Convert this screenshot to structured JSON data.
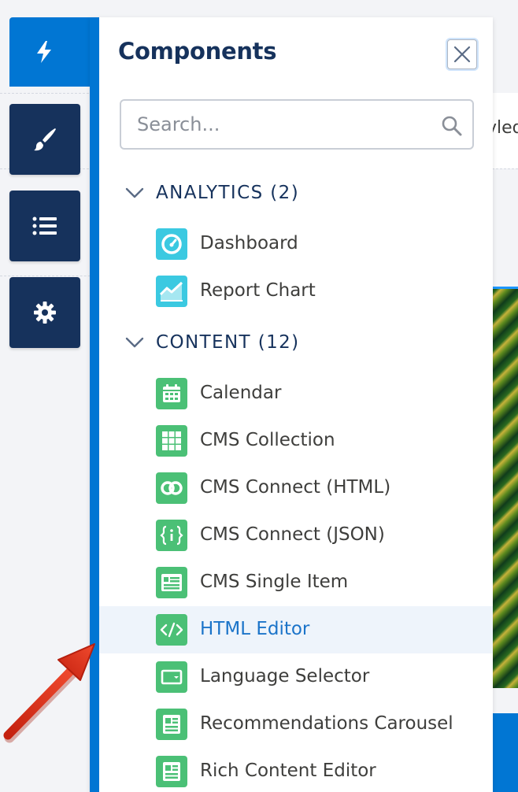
{
  "background": {
    "peek_text": "vled"
  },
  "rail": {
    "items": [
      {
        "icon": "lightning-icon",
        "active": true
      },
      {
        "icon": "paintbrush-icon",
        "active": false
      },
      {
        "icon": "list-icon",
        "active": false
      },
      {
        "icon": "gear-icon",
        "active": false
      }
    ]
  },
  "panel": {
    "title": "Components",
    "close_icon": "close-icon",
    "search": {
      "placeholder": "Search...",
      "value": ""
    },
    "sections": [
      {
        "label": "ANALYTICS (2)",
        "expanded": true,
        "items": [
          {
            "label": "Dashboard",
            "icon": "dashboard-icon",
            "color": "#3bc9e1"
          },
          {
            "label": "Report Chart",
            "icon": "report-chart-icon",
            "color": "#3bc9e1"
          }
        ]
      },
      {
        "label": "CONTENT (12)",
        "expanded": true,
        "items": [
          {
            "label": "Calendar",
            "icon": "calendar-icon",
            "color": "#4bc076"
          },
          {
            "label": "CMS Collection",
            "icon": "grid-icon",
            "color": "#4bc076"
          },
          {
            "label": "CMS Connect (HTML)",
            "icon": "link-circles-icon",
            "color": "#4bc076"
          },
          {
            "label": "CMS Connect (JSON)",
            "icon": "json-braces-icon",
            "color": "#4bc076"
          },
          {
            "label": "CMS Single Item",
            "icon": "single-item-icon",
            "color": "#4bc076"
          },
          {
            "label": "HTML Editor",
            "icon": "code-icon",
            "color": "#4bc076",
            "selected": true
          },
          {
            "label": "Language Selector",
            "icon": "language-selector-icon",
            "color": "#4bc076"
          },
          {
            "label": "Recommendations Carousel",
            "icon": "document-icon",
            "color": "#4bc076"
          },
          {
            "label": "Rich Content Editor",
            "icon": "document-icon",
            "color": "#4bc076"
          }
        ]
      }
    ]
  },
  "colors": {
    "accent_blue": "#0176d3",
    "rail_dark": "#16325c",
    "analytics_teal": "#3bc9e1",
    "content_green": "#4bc076",
    "annotation_arrow": "#e0301e"
  }
}
